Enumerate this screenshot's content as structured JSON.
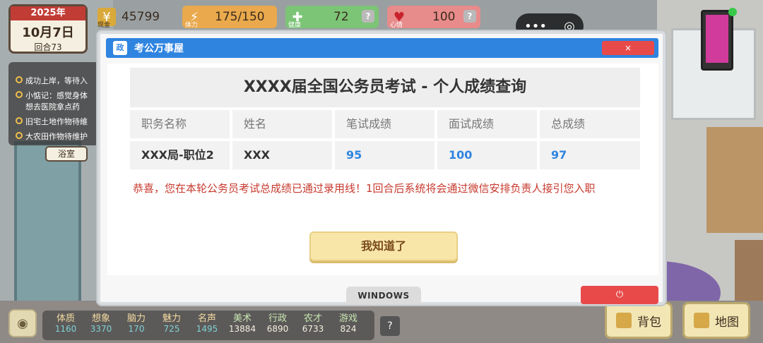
{
  "hud": {
    "date": {
      "year": "2025年",
      "day": "10月7日",
      "turn": "回合73"
    },
    "cash": {
      "label": "现金",
      "value": "45799"
    },
    "energy": {
      "label": "体力",
      "value": "175/150",
      "help": "?"
    },
    "health": {
      "label": "健康",
      "value": "72",
      "help": "?"
    },
    "mood": {
      "label": "心情",
      "value": "100",
      "help": "?"
    },
    "capsule": {
      "menu": "•••",
      "target": "◎"
    }
  },
  "tasks": [
    {
      "text": "成功上岸，等待入"
    },
    {
      "text": "小惦记：感觉身体",
      "sub": "想去医院拿点药"
    },
    {
      "text": "旧宅土地作物待維"
    },
    {
      "text": "大农田作物待维护"
    }
  ],
  "room_tag": "浴室",
  "modal": {
    "title": "考公万事屋",
    "logo": "政",
    "close": "×",
    "grade_title": "XXXX届全国公务员考试 - 个人成绩查询",
    "headers": [
      "职务名称",
      "姓名",
      "笔试成绩",
      "面试成绩",
      "总成绩"
    ],
    "row": [
      "XXX局-职位2",
      "XXX",
      "95",
      "100",
      "97"
    ],
    "message": "恭喜，您在本轮公务员考试总成绩已通过录用线！1回合后系统将会通过微信安排负责人接引您入职",
    "ok_button": "我知道了",
    "windows_button": "WINDOWS",
    "power_button": "⏻"
  },
  "attributes": [
    {
      "name": "体质",
      "value": "1160"
    },
    {
      "name": "想象",
      "value": "3370"
    },
    {
      "name": "脑力",
      "value": "170"
    },
    {
      "name": "魅力",
      "value": "725"
    },
    {
      "name": "名声",
      "value": "1495"
    },
    {
      "name": "美术",
      "value": "13884"
    },
    {
      "name": "行政",
      "value": "6890"
    },
    {
      "name": "农才",
      "value": "6733"
    },
    {
      "name": "游戏",
      "value": "824"
    }
  ],
  "attributes_help": "?",
  "bottom_buttons": {
    "bag": "背包",
    "map": "地图"
  }
}
